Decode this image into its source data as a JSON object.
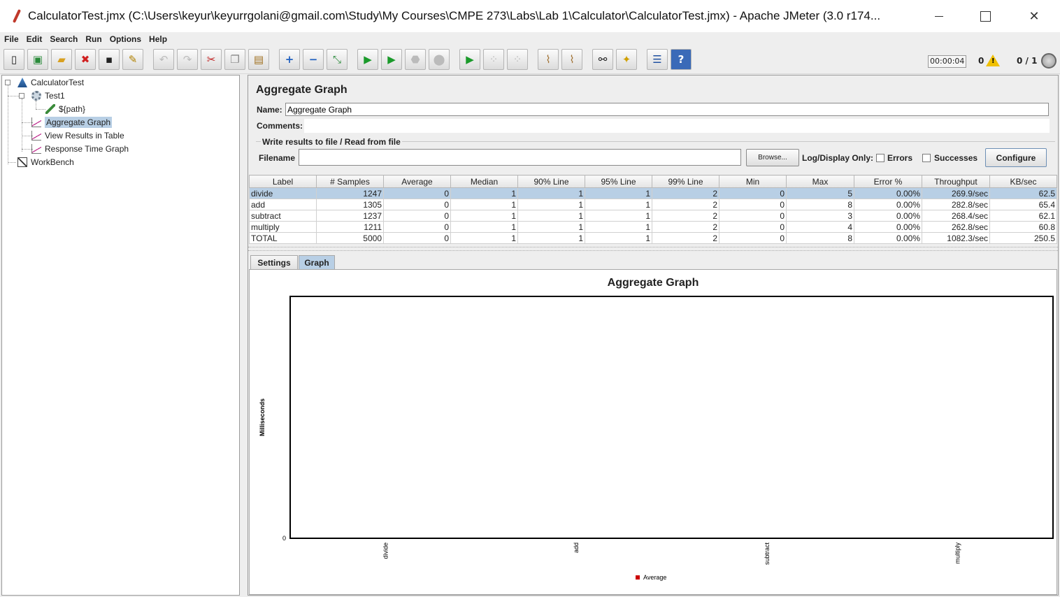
{
  "window": {
    "title": "CalculatorTest.jmx (C:\\Users\\keyur\\keyurrgolani@gmail.com\\Study\\My Courses\\CMPE 273\\Labs\\Lab 1\\Calculator\\CalculatorTest.jmx) - Apache JMeter (3.0 r174..."
  },
  "menu": [
    "File",
    "Edit",
    "Search",
    "Run",
    "Options",
    "Help"
  ],
  "toolbar": {
    "buttons": [
      "new-icon",
      "templates-icon",
      "open-icon",
      "close-icon",
      "save-icon",
      "save-as-icon",
      "undo-icon",
      "redo-icon",
      "cut-icon",
      "copy-icon",
      "paste-icon",
      "expand-icon",
      "collapse-icon",
      "toggle-icon",
      "start-icon",
      "start-no-pause-icon",
      "stop-icon",
      "shutdown-icon",
      "remote-start-icon",
      "remote-stop-icon",
      "remote-shutdown-icon",
      "clear-icon",
      "clear-all-icon",
      "search-icon",
      "reset-search-icon",
      "function-helper-icon",
      "help-icon"
    ],
    "timer": "00:00:04",
    "warnings": "0",
    "threads": "0 / 1"
  },
  "tree": {
    "nodes": [
      {
        "label": "CalculatorTest",
        "icon": "test-plan-icon"
      },
      {
        "label": "Test1",
        "icon": "thread-group-icon"
      },
      {
        "label": "${path}",
        "icon": "sampler-icon"
      },
      {
        "label": "Aggregate Graph",
        "icon": "graph-listener-icon",
        "selected": true
      },
      {
        "label": "View Results in Table",
        "icon": "graph-listener-icon"
      },
      {
        "label": "Response Time Graph",
        "icon": "graph-listener-icon"
      },
      {
        "label": "WorkBench",
        "icon": "workbench-icon"
      }
    ]
  },
  "panel": {
    "title": "Aggregate Graph",
    "name_label": "Name:",
    "name_value": "Aggregate Graph",
    "comments_label": "Comments:",
    "write_group_title": "Write results to file / Read from file",
    "filename_label": "Filename",
    "filename_value": "",
    "browse_label": "Browse...",
    "log_display_label": "Log/Display Only:",
    "errors_label": "Errors",
    "successes_label": "Successes",
    "configure_label": "Configure"
  },
  "table": {
    "columns": [
      "Label",
      "# Samples",
      "Average",
      "Median",
      "90% Line",
      "95% Line",
      "99% Line",
      "Min",
      "Max",
      "Error %",
      "Throughput",
      "KB/sec"
    ],
    "rows": [
      [
        "divide",
        "1247",
        "0",
        "1",
        "1",
        "1",
        "2",
        "0",
        "5",
        "0.00%",
        "269.9/sec",
        "62.5"
      ],
      [
        "add",
        "1305",
        "0",
        "1",
        "1",
        "1",
        "2",
        "0",
        "8",
        "0.00%",
        "282.8/sec",
        "65.4"
      ],
      [
        "subtract",
        "1237",
        "0",
        "1",
        "1",
        "1",
        "2",
        "0",
        "3",
        "0.00%",
        "268.4/sec",
        "62.1"
      ],
      [
        "multiply",
        "1211",
        "0",
        "1",
        "1",
        "1",
        "2",
        "0",
        "4",
        "0.00%",
        "262.8/sec",
        "60.8"
      ],
      [
        "TOTAL",
        "5000",
        "0",
        "1",
        "1",
        "1",
        "2",
        "0",
        "8",
        "0.00%",
        "1082.3/sec",
        "250.5"
      ]
    ],
    "selected_row": 0
  },
  "tabs": [
    {
      "label": "Settings",
      "active": false
    },
    {
      "label": "Graph",
      "active": true
    }
  ],
  "chart_data": {
    "type": "bar",
    "title": "Aggregate Graph",
    "ylabel": "Milliseconds",
    "xlabel": "",
    "categories": [
      "divide",
      "add",
      "subtract",
      "multiply"
    ],
    "series": [
      {
        "name": "Average",
        "values": [
          0,
          0,
          0,
          0
        ]
      }
    ],
    "yticks": [
      "0"
    ],
    "ylim": [
      0,
      1
    ],
    "legend_position": "bottom",
    "series_color": "#cc0000"
  }
}
